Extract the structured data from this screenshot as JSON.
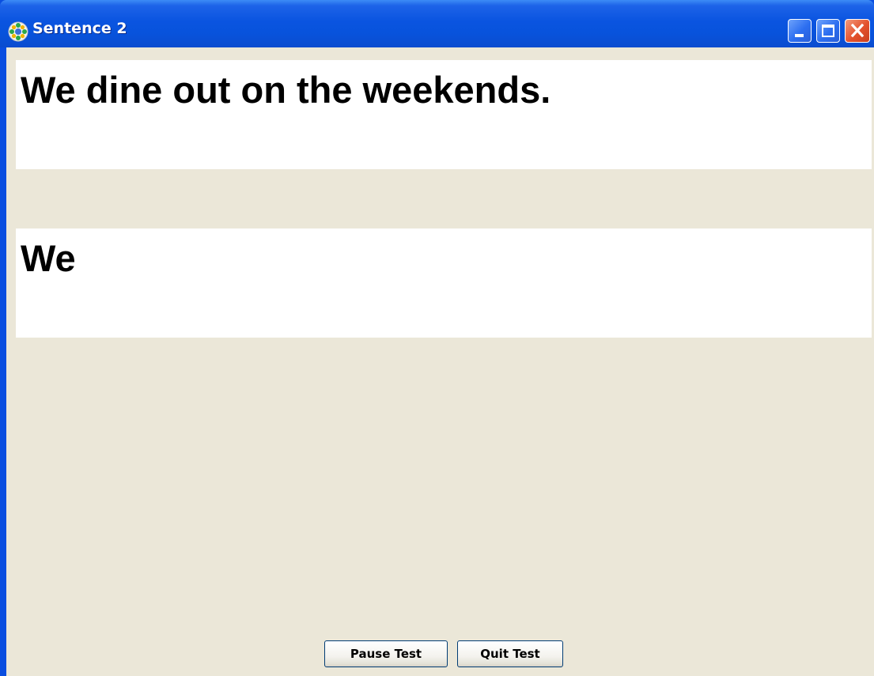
{
  "window": {
    "title": "Sentence 2",
    "app_icon": "gear-flower-icon",
    "controls": {
      "minimize": "minimize-icon",
      "maximize": "maximize-icon",
      "close": "close-icon"
    }
  },
  "target_sentence": "We dine out on the weekends.",
  "typed_text": "We",
  "buttons": {
    "pause_label": "Pause Test",
    "quit_label": "Quit Test"
  },
  "colors": {
    "titlebar": "#0a54e0",
    "client_background": "#ebe7d8",
    "panel_background": "#ffffff",
    "close_button": "#e3512c"
  }
}
